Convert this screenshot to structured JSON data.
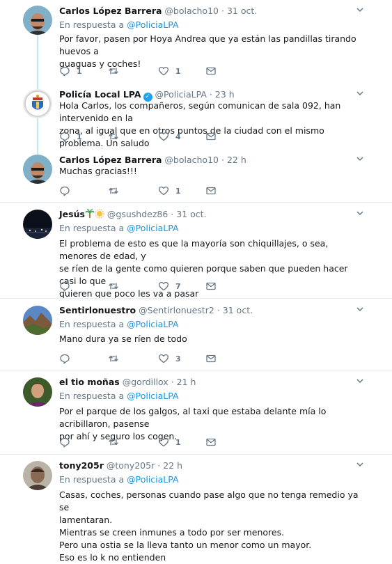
{
  "tweets": [
    {
      "name": "Carlos López Barrera",
      "handle": "@bolacho10",
      "sep": "·",
      "time": "31 oct.",
      "reply_to_prefix": "En respuesta a",
      "reply_to_handle": "@PoliciaLPA",
      "lines": [
        "Por favor, pasen por Hoya Andrea que ya están las pandillas tirando huevos a",
        "guaguas y coches!"
      ],
      "replies": "1",
      "retweets": "",
      "likes": "1"
    },
    {
      "name": "Policía Local LPA",
      "verified_glyph": "✓",
      "handle": "@PoliciaLPA",
      "sep": "·",
      "time": "23 h",
      "lines": [
        "Hola Carlos, los compañeros, según comunican de sala 092, han intervenido en la",
        "zona, al igual que en otros puntos de la ciudad con el mismo problema. Un saludo"
      ],
      "replies": "1",
      "retweets": "",
      "likes": "4"
    },
    {
      "name": "Carlos López Barrera",
      "handle": "@bolacho10",
      "sep": "·",
      "time": "22 h",
      "lines": [
        "Muchas gracias!!!"
      ],
      "replies": "",
      "retweets": "",
      "likes": "1"
    },
    {
      "name": "Jesús",
      "name_emoji": [
        "palm-tree",
        "sun"
      ],
      "handle": "@gsushdez86",
      "sep": "·",
      "time": "31 oct.",
      "reply_to_prefix": "En respuesta a",
      "reply_to_handle": "@PoliciaLPA",
      "lines": [
        "El problema de esto es que la mayoría son chiquillajes, o sea, menores de edad, y",
        "se ríen de la gente como quieren porque saben que pueden hacer casi lo que",
        "quieren que poco les va a pasar"
      ],
      "replies": "",
      "retweets": "",
      "likes": "7"
    },
    {
      "name": "Sentirlonuestro",
      "handle": "@Sentirlonuestr2",
      "sep": "·",
      "time": "31 oct.",
      "reply_to_prefix": "En respuesta a",
      "reply_to_handle": "@PoliciaLPA",
      "lines": [
        "Mano dura ya se ríen de todo"
      ],
      "replies": "",
      "retweets": "",
      "likes": "3"
    },
    {
      "name": "el tio moñas",
      "handle": "@gordillox",
      "sep": "·",
      "time": "21 h",
      "reply_to_prefix": "En respuesta a",
      "reply_to_handle": "@PoliciaLPA",
      "lines": [
        "Por el parque de los galgos, al taxi que estaba delante mía lo acribillaron, pasense",
        "por ahí y seguro los cogen."
      ],
      "replies": "",
      "retweets": "",
      "likes": "1"
    },
    {
      "name": "tony205r",
      "handle": "@tony205r",
      "sep": "·",
      "time": "22 h",
      "reply_to_prefix": "En respuesta a",
      "reply_to_handle": "@PoliciaLPA",
      "lines": [
        "Casas, coches, personas cuando pase algo que no tenga remedio ya se",
        "lamentaran.",
        "Mientras se creen inmunes a todo por ser menores.",
        "Pero una ostia se la lleva tanto un menor como un mayor.",
        "Eso es lo k no entienden"
      ],
      "replies": "",
      "retweets": "",
      "likes": ""
    }
  ],
  "icons": {
    "reply": "reply-icon",
    "retweet": "retweet-icon",
    "like": "heart-icon",
    "dm": "envelope-icon",
    "menu": "chevron-down-icon"
  },
  "colors": {
    "link": "#1b95e0",
    "muted": "#657786",
    "thread_line": "#c4e6f7",
    "verified": "#1da1f2"
  }
}
